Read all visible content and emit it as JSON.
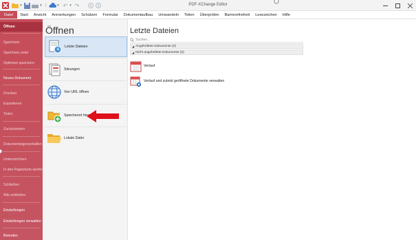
{
  "window": {
    "title": "PDF-XChange Editor"
  },
  "menu": [
    "Datei",
    "Start",
    "Ansicht",
    "Anmerkungen",
    "Schützen",
    "Formular",
    "Dokumentaufbau",
    "Umwandeln",
    "Teilen",
    "Überprüfen",
    "Barrierefreiheit",
    "Lesezeichen",
    "Hilfe"
  ],
  "sidebar": {
    "items": [
      {
        "label": "Öffnen",
        "state": "selected"
      },
      {
        "label": "Speichern",
        "state": "disabled"
      },
      {
        "label": "Speichern unter",
        "state": "disabled"
      },
      {
        "label": "Optimiert speichern",
        "state": "disabled"
      },
      {
        "label": "Neues Dokument",
        "state": "enabled"
      },
      {
        "label": "Drucken",
        "state": "disabled"
      },
      {
        "label": "Exportieren",
        "state": "disabled"
      },
      {
        "label": "Teilen",
        "state": "disabled"
      },
      {
        "label": "Zurücksetzen",
        "state": "disabled"
      },
      {
        "label": "Dokumenteigenschaften",
        "state": "disabled"
      },
      {
        "label": "Unterzeichnen",
        "state": "disabled"
      },
      {
        "label": "In den Papierkorb werfen",
        "state": "disabled"
      },
      {
        "label": "Schließen",
        "state": "disabled"
      },
      {
        "label": "Alle schließen",
        "state": "disabled"
      },
      {
        "label": "Einstellungen",
        "state": "enabled"
      },
      {
        "label": "Einstellungen verwalten",
        "state": "enabled"
      },
      {
        "label": "Beenden",
        "state": "enabled"
      }
    ]
  },
  "open_panel": {
    "title": "Öffnen",
    "items": [
      {
        "label": "Letzte Dateien",
        "icon": "recent-files-icon",
        "selected": true
      },
      {
        "label": "Sitzungen",
        "icon": "sessions-icon",
        "selected": false
      },
      {
        "label": "Von URL öffnen",
        "icon": "globe-icon",
        "selected": false
      },
      {
        "label": "Speicherort hinzufügen",
        "icon": "add-location-icon",
        "selected": false
      },
      {
        "label": "Lokale Datei",
        "icon": "folder-icon",
        "selected": false
      }
    ]
  },
  "recent": {
    "title": "Letzte Dateien",
    "search_placeholder": "Suchen...",
    "groups": [
      "Angeheftete Dokumente (0)",
      "Nicht angeheftete Dokumente (0)"
    ],
    "rows": [
      {
        "label": "Verlauf",
        "icon": "calendar-icon"
      },
      {
        "label": "Verlauf und zuletzt geöffnete Dokumente verwalten",
        "icon": "calendar-gear-icon"
      }
    ]
  },
  "colors": {
    "sidebar": "#c64d59",
    "sidebar_selected": "#a8323f",
    "selection": "#d8e6f5",
    "arrow": "#e0101a"
  }
}
